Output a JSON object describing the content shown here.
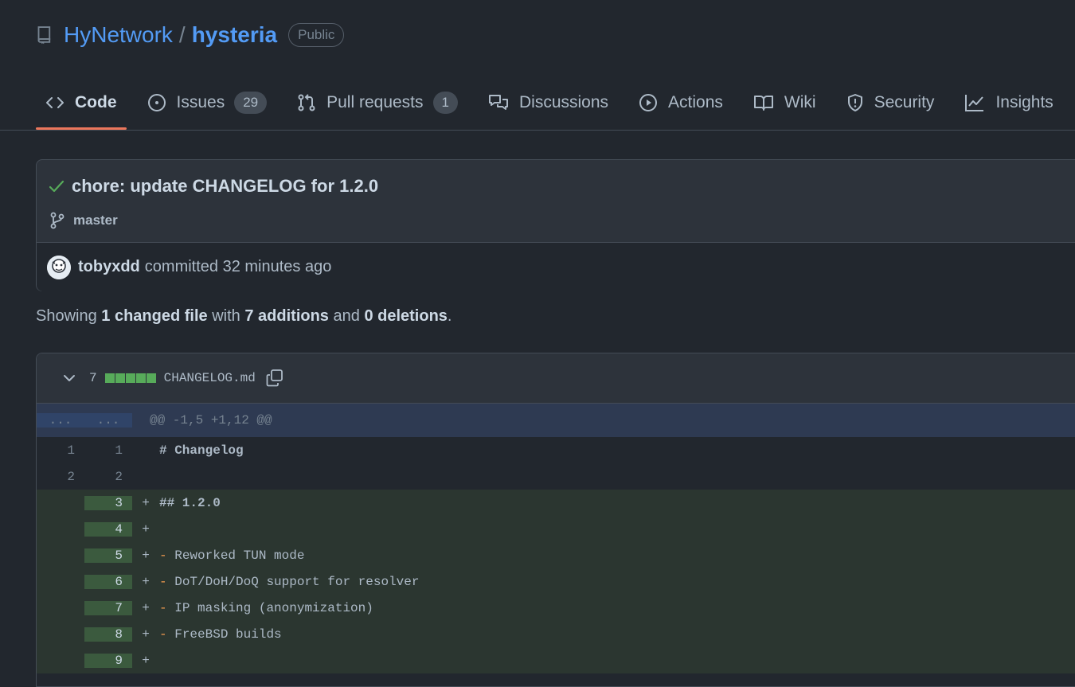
{
  "repo": {
    "owner": "HyNetwork",
    "separator": "/",
    "name": "hysteria",
    "visibility": "Public"
  },
  "tabs": [
    {
      "label": "Code",
      "icon": "code-icon",
      "selected": true
    },
    {
      "label": "Issues",
      "icon": "issue-opened-icon",
      "count": "29"
    },
    {
      "label": "Pull requests",
      "icon": "git-pull-request-icon",
      "count": "1"
    },
    {
      "label": "Discussions",
      "icon": "comment-discussion-icon"
    },
    {
      "label": "Actions",
      "icon": "play-icon"
    },
    {
      "label": "Wiki",
      "icon": "book-icon"
    },
    {
      "label": "Security",
      "icon": "shield-icon"
    },
    {
      "label": "Insights",
      "icon": "graph-icon"
    }
  ],
  "commit": {
    "title": "chore: update CHANGELOG for 1.2.0",
    "branch": "master",
    "author": "tobyxdd",
    "committed_text": "committed 32 minutes ago",
    "status_color": "#57ab5a"
  },
  "summary": {
    "showing": "Showing",
    "changed": "1 changed file",
    "with": "with",
    "additions": "7 additions",
    "and": "and",
    "deletions": "0 deletions",
    "end": "."
  },
  "file": {
    "changes": "7",
    "name": "CHANGELOG.md",
    "hunk_old": "...",
    "hunk_new": "...",
    "hunk_header": "@@ -1,5 +1,12 @@",
    "lines": [
      {
        "old": "1",
        "new": "1",
        "marker": "",
        "type": "ctx",
        "code": "# Changelog"
      },
      {
        "old": "2",
        "new": "2",
        "marker": "",
        "type": "ctx",
        "code": ""
      },
      {
        "old": "",
        "new": "3",
        "marker": "+",
        "type": "add",
        "code": "## 1.2.0"
      },
      {
        "old": "",
        "new": "4",
        "marker": "+",
        "type": "add",
        "code": ""
      },
      {
        "old": "",
        "new": "5",
        "marker": "+",
        "type": "add",
        "dash": "-",
        "code": "Reworked TUN mode"
      },
      {
        "old": "",
        "new": "6",
        "marker": "+",
        "type": "add",
        "dash": "-",
        "code": "DoT/DoH/DoQ support for resolver"
      },
      {
        "old": "",
        "new": "7",
        "marker": "+",
        "type": "add",
        "dash": "-",
        "code": "IP masking (anonymization)"
      },
      {
        "old": "",
        "new": "8",
        "marker": "+",
        "type": "add",
        "dash": "-",
        "code": "FreeBSD builds"
      },
      {
        "old": "",
        "new": "9",
        "marker": "+",
        "type": "add",
        "code": ""
      }
    ]
  }
}
